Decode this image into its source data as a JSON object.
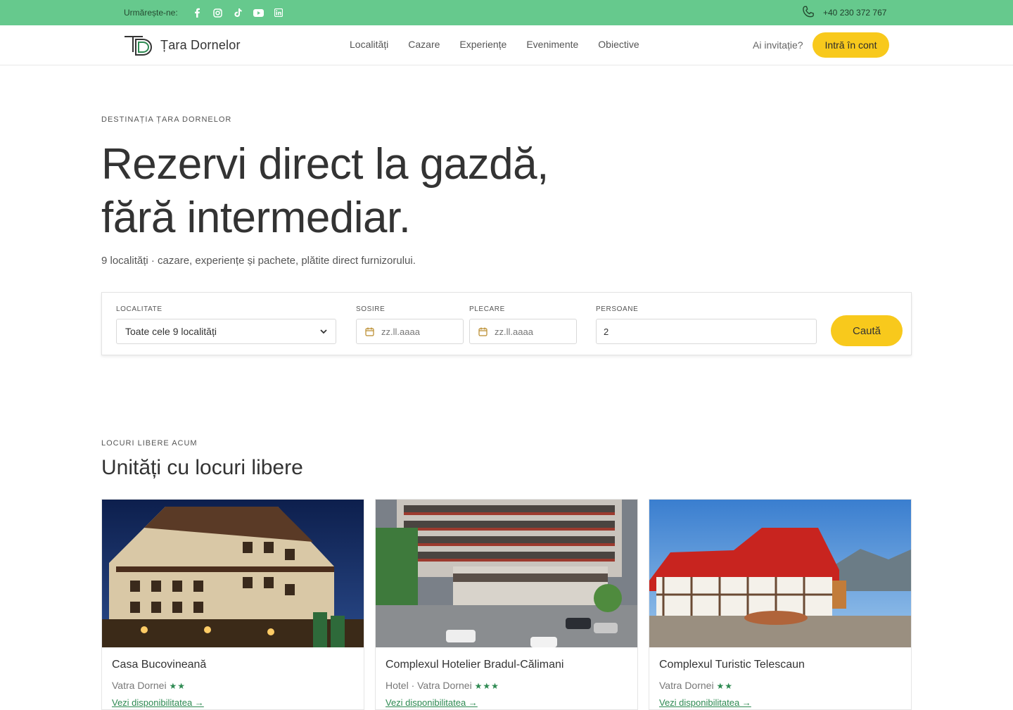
{
  "topbar": {
    "follow_label": "Urmărește-ne:",
    "socials": [
      "facebook-icon",
      "instagram-icon",
      "tiktok-icon",
      "youtube-icon",
      "linkedin-icon"
    ],
    "phone": "+40 230 372 767"
  },
  "header": {
    "brand": "Țara Dornelor",
    "nav": [
      "Localități",
      "Cazare",
      "Experiențe",
      "Evenimente",
      "Obiective"
    ],
    "invite": "Ai invitație?",
    "login": "Intră în cont"
  },
  "hero": {
    "eyebrow": "DESTINAȚIA ȚARA DORNELOR",
    "title_line1": "Rezervi direct la gazdă,",
    "title_line2": "fără intermediar.",
    "subtitle": "9 localități · cazare, experiențe și pachete, plătite direct furnizorului."
  },
  "search": {
    "location_label": "LOCALITATE",
    "location_value": "Toate cele 9 localități",
    "checkin_label": "SOSIRE",
    "checkin_placeholder": "zz.ll.aaaa",
    "checkout_label": "PLECARE",
    "checkout_placeholder": "zz.ll.aaaa",
    "persons_label": "PERSOANE",
    "persons_value": "2",
    "button": "Caută"
  },
  "listings": {
    "eyebrow": "LOCURI LIBERE ACUM",
    "title": "Unități cu locuri libere",
    "cards": [
      {
        "name": "Casa Bucovineană",
        "meta": "Vatra Dornei",
        "stars": "★★",
        "link": "Vezi disponibilitatea →"
      },
      {
        "name": "Complexul Hotelier Bradul-Călimani",
        "meta": "Hotel · Vatra Dornei",
        "stars": "★★★",
        "link": "Vezi disponibilitatea →"
      },
      {
        "name": "Complexul Turistic Telescaun",
        "meta": "Vatra Dornei",
        "stars": "★★",
        "link": "Vezi disponibilitatea →"
      }
    ]
  },
  "colors": {
    "topbar": "#66c98d",
    "accent": "#f8c91c",
    "green_text": "#2e8a52"
  }
}
